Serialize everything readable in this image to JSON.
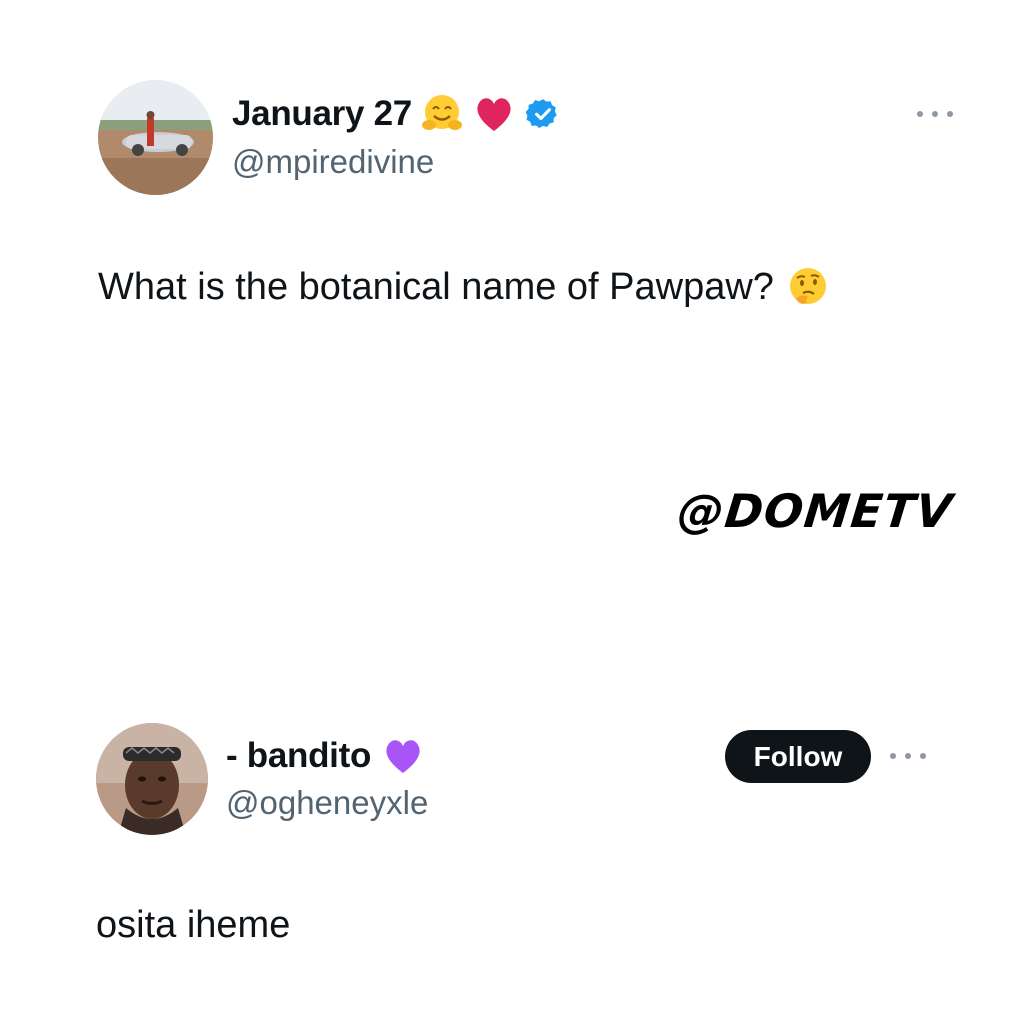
{
  "tweet": {
    "author": {
      "display_name": "January 27",
      "handle": "@mpiredivine",
      "name_emojis": [
        "hugging-face-emoji",
        "red-heart-emoji"
      ],
      "verified": true,
      "avatar": "avatar-person-with-car-photo"
    },
    "text": "What is the botanical name of Pawpaw?",
    "text_emoji": "thinking-face-emoji",
    "more_icon": "more-horizontal-icon"
  },
  "watermark": "@DOMETV",
  "reply": {
    "author": {
      "display_name": "- bandito",
      "handle": "@ogheneyxle",
      "name_emoji": "purple-heart-emoji",
      "avatar": "avatar-man-headband-photo"
    },
    "follow_label": "Follow",
    "text": "osita iheme",
    "more_icon": "more-horizontal-icon"
  },
  "colors": {
    "text_primary": "#0f1419",
    "text_secondary": "#536471",
    "verified_blue": "#1d9bf0",
    "follow_bg": "#0f1419",
    "follow_text": "#ffffff",
    "heart_red": "#e0245e",
    "heart_purple": "#a855f7"
  }
}
